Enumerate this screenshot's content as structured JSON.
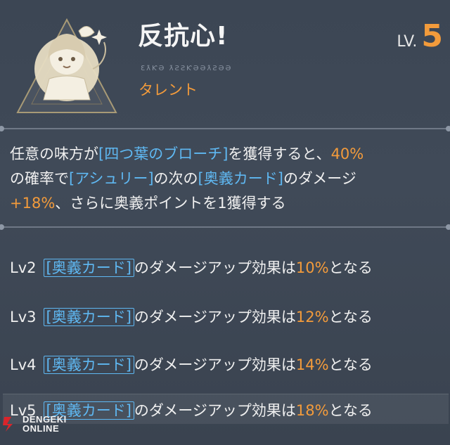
{
  "header": {
    "title": "反抗心!",
    "level_label": "LV.",
    "level_value": "5",
    "rune_text": "ƐƛƘƏ ƛƧƧƘƏƏƛƧƏƏ",
    "subtitle": "タレント",
    "portrait_icon": "chibi-character-emblem"
  },
  "description": {
    "p1": "任意の味方が",
    "t1": "[四つ葉のブローチ]",
    "p2": "を獲得すると、",
    "v1": "40%",
    "p3": "の確率で",
    "t2": "[アシュリー]",
    "p4": "の次の",
    "t3": "[奥義カード]",
    "p5": "のダメージ",
    "v2": "+18%",
    "p6": "、さらに奥義ポイントを1獲得する"
  },
  "levels": [
    {
      "lv": "Lv2",
      "tag": "[奥義カード]",
      "text": "のダメージアップ効果は",
      "value": "10%",
      "suffix": "となる"
    },
    {
      "lv": "Lv3",
      "tag": "[奥義カード]",
      "text": "のダメージアップ効果は",
      "value": "12%",
      "suffix": "となる"
    },
    {
      "lv": "Lv4",
      "tag": "[奥義カード]",
      "text": "のダメージアップ効果は",
      "value": "14%",
      "suffix": "となる"
    },
    {
      "lv": "Lv5",
      "tag": "[奥義カード]",
      "text": "のダメージアップ効果は",
      "value": "18%",
      "suffix": "となる"
    }
  ],
  "watermark": {
    "top": "DENGEKI",
    "bottom": "ONLINE"
  },
  "colors": {
    "accent_orange": "#f39b3b",
    "link_blue": "#5fb8f2",
    "background": "#3e4856"
  }
}
